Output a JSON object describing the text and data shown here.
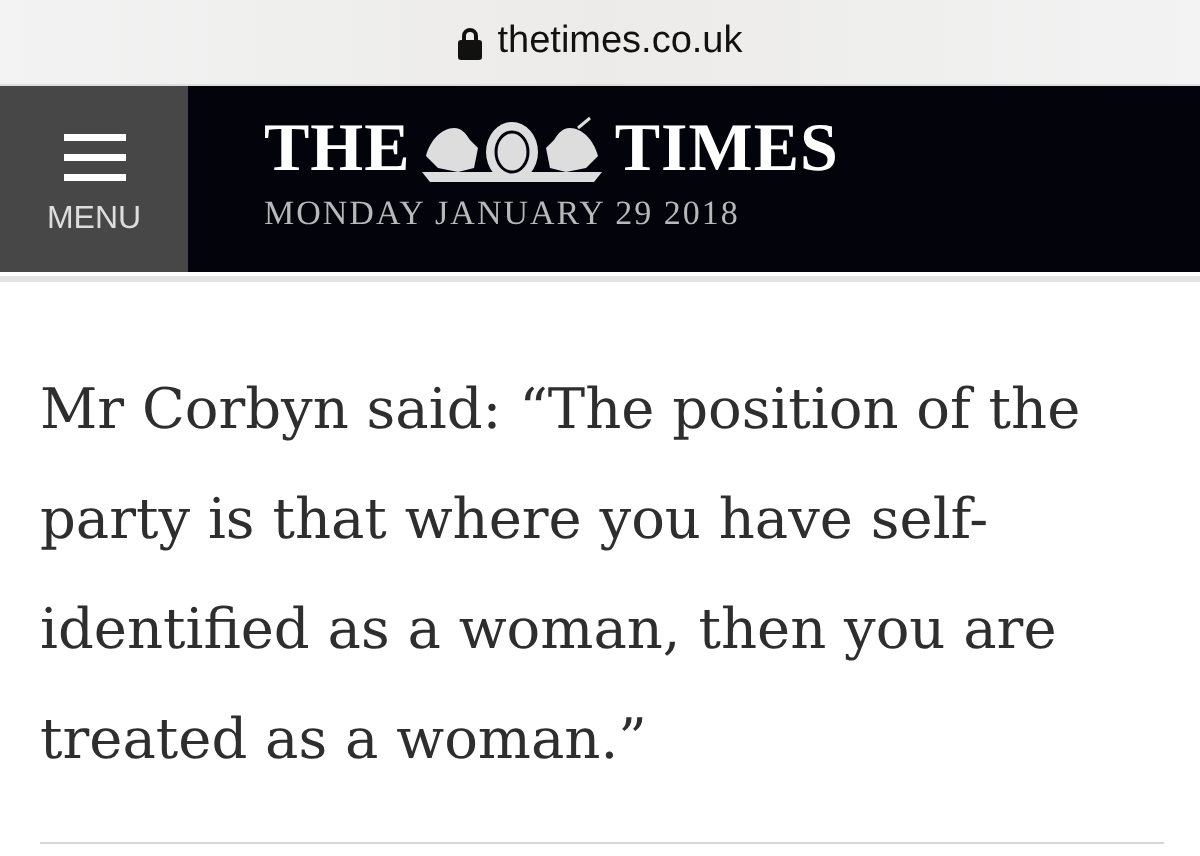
{
  "address_bar": {
    "url": "thetimes.co.uk",
    "secure": true
  },
  "header": {
    "menu_label": "MENU",
    "masthead": {
      "left": "THE",
      "right": "TIMES"
    },
    "date": "MONDAY JANUARY 29 2018"
  },
  "article": {
    "paragraph": "Mr Corbyn said: “The position of the party is that where you have self-identified as a woman, then you are treated as a woman.”"
  }
}
